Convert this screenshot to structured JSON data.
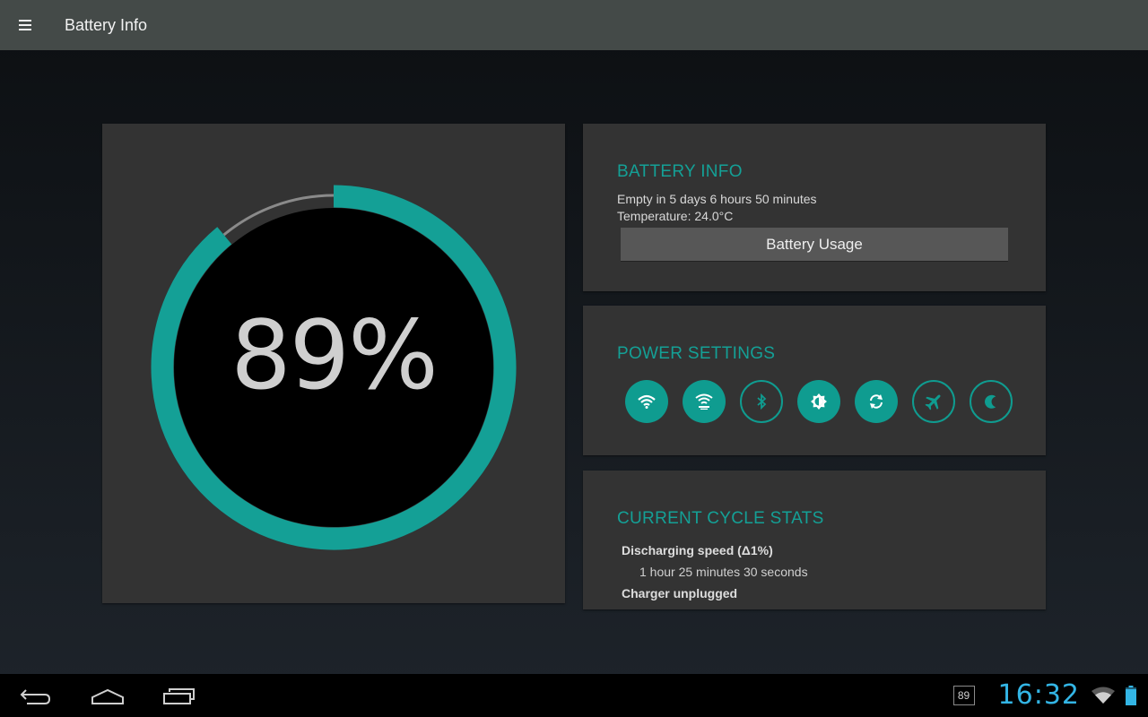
{
  "app": {
    "title": "Battery Info"
  },
  "gauge": {
    "level_percent": 89,
    "label": "89%",
    "color": "#14a096",
    "track_color": "#8a8a8a"
  },
  "battery_info": {
    "title": "BATTERY INFO",
    "empty_in": "Empty in 5 days 6 hours 50 minutes",
    "temperature": "Temperature: 24.0°C",
    "usage_button": "Battery Usage"
  },
  "power_settings": {
    "title": "POWER SETTINGS",
    "toggles": [
      {
        "name": "wifi",
        "icon": "wifi-icon",
        "on": true
      },
      {
        "name": "wifi-hotspot",
        "icon": "wifi-hotspot-icon",
        "on": true
      },
      {
        "name": "bluetooth",
        "icon": "bluetooth-icon",
        "on": false
      },
      {
        "name": "brightness",
        "icon": "brightness-icon",
        "on": true
      },
      {
        "name": "auto-sync",
        "icon": "sync-icon",
        "on": true
      },
      {
        "name": "airplane-mode",
        "icon": "airplane-icon",
        "on": false
      },
      {
        "name": "night-mode",
        "icon": "moon-icon",
        "on": false
      }
    ]
  },
  "cycle_stats": {
    "title": "CURRENT CYCLE STATS",
    "discharging_label": "Discharging speed (Δ1%)",
    "discharging_value": "1 hour 25 minutes 30 seconds",
    "unplugged_label": "Charger unplugged"
  },
  "status_bar": {
    "battery_level": "89",
    "clock": "16:32",
    "accent": "#33b5e5"
  }
}
